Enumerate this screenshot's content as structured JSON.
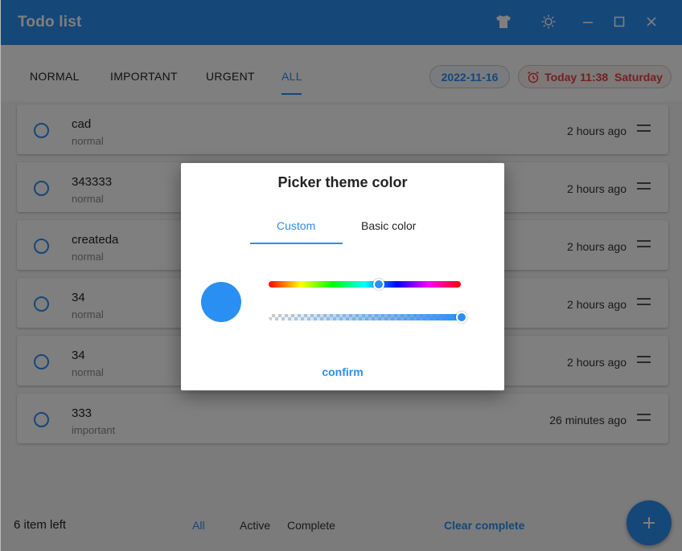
{
  "window": {
    "title": "Todo list",
    "controls": {
      "theme_icon": "tshirt-icon",
      "brightness_icon": "sun-icon",
      "minimize_icon": "minimize-icon",
      "maximize_icon": "maximize-icon",
      "close_icon": "close-icon"
    },
    "accent_color": "#2a8ff2"
  },
  "tabs": [
    {
      "label": "NORMAL",
      "active": false
    },
    {
      "label": "IMPORTANT",
      "active": false
    },
    {
      "label": "URGENT",
      "active": false
    },
    {
      "label": "ALL",
      "active": true
    }
  ],
  "date_pill": "2022-11-16",
  "clock_pill": {
    "icon": "alarm-clock-icon",
    "text": "Today 11:38  Saturday",
    "color": "#e64040"
  },
  "todos": [
    {
      "name": "cad",
      "tag": "normal",
      "time": "2 hours ago"
    },
    {
      "name": "343333",
      "tag": "normal",
      "time": "2 hours ago"
    },
    {
      "name": "createda",
      "tag": "normal",
      "time": "2 hours ago"
    },
    {
      "name": "34",
      "tag": "normal",
      "time": "2 hours ago"
    },
    {
      "name": "34",
      "tag": "normal",
      "time": "2 hours ago"
    },
    {
      "name": "333",
      "tag": "important",
      "time": "26 minutes ago"
    }
  ],
  "footer": {
    "items_left": "6 item left",
    "filters": [
      {
        "label": "All",
        "active": true
      },
      {
        "label": "Active",
        "active": false
      },
      {
        "label": "Complete",
        "active": false
      }
    ],
    "clear_label": "Clear complete",
    "add_icon": "plus-icon"
  },
  "dialog": {
    "title": "Picker theme color",
    "tabs": [
      {
        "label": "Custom",
        "active": true
      },
      {
        "label": "Basic color",
        "active": false
      }
    ],
    "selected_color": "#2a8ff2",
    "hue_position": 0.575,
    "alpha_value": 1.0,
    "confirm_label": "confirm"
  }
}
